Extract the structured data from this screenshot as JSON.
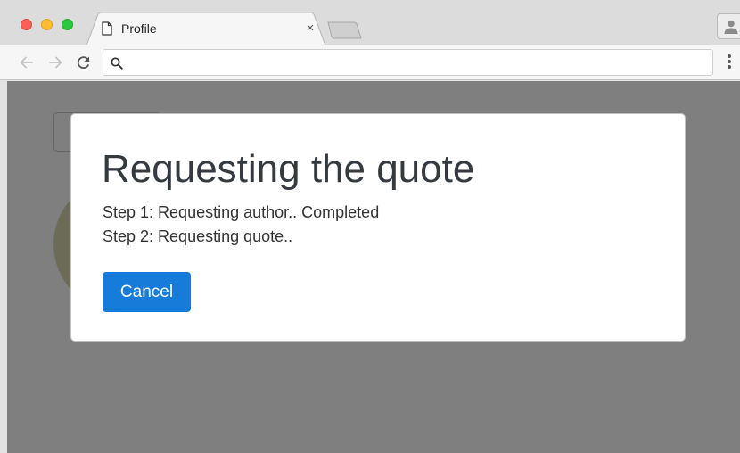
{
  "browser": {
    "tab": {
      "title": "Profile",
      "close_glyph": "×",
      "icon": "document-icon"
    },
    "omnibox": {
      "value": "",
      "placeholder": "",
      "icon": "search-icon"
    }
  },
  "modal": {
    "title": "Requesting the quote",
    "steps": [
      "Step 1: Requesting author.. Completed",
      "Step 2: Requesting quote.."
    ],
    "cancel_label": "Cancel"
  },
  "colors": {
    "primary_button": "#177bd9",
    "backdrop": "rgba(0,0,0,0.5)",
    "traffic_red": "#fd5f57",
    "traffic_yellow": "#febc2e",
    "traffic_green": "#28c840"
  }
}
